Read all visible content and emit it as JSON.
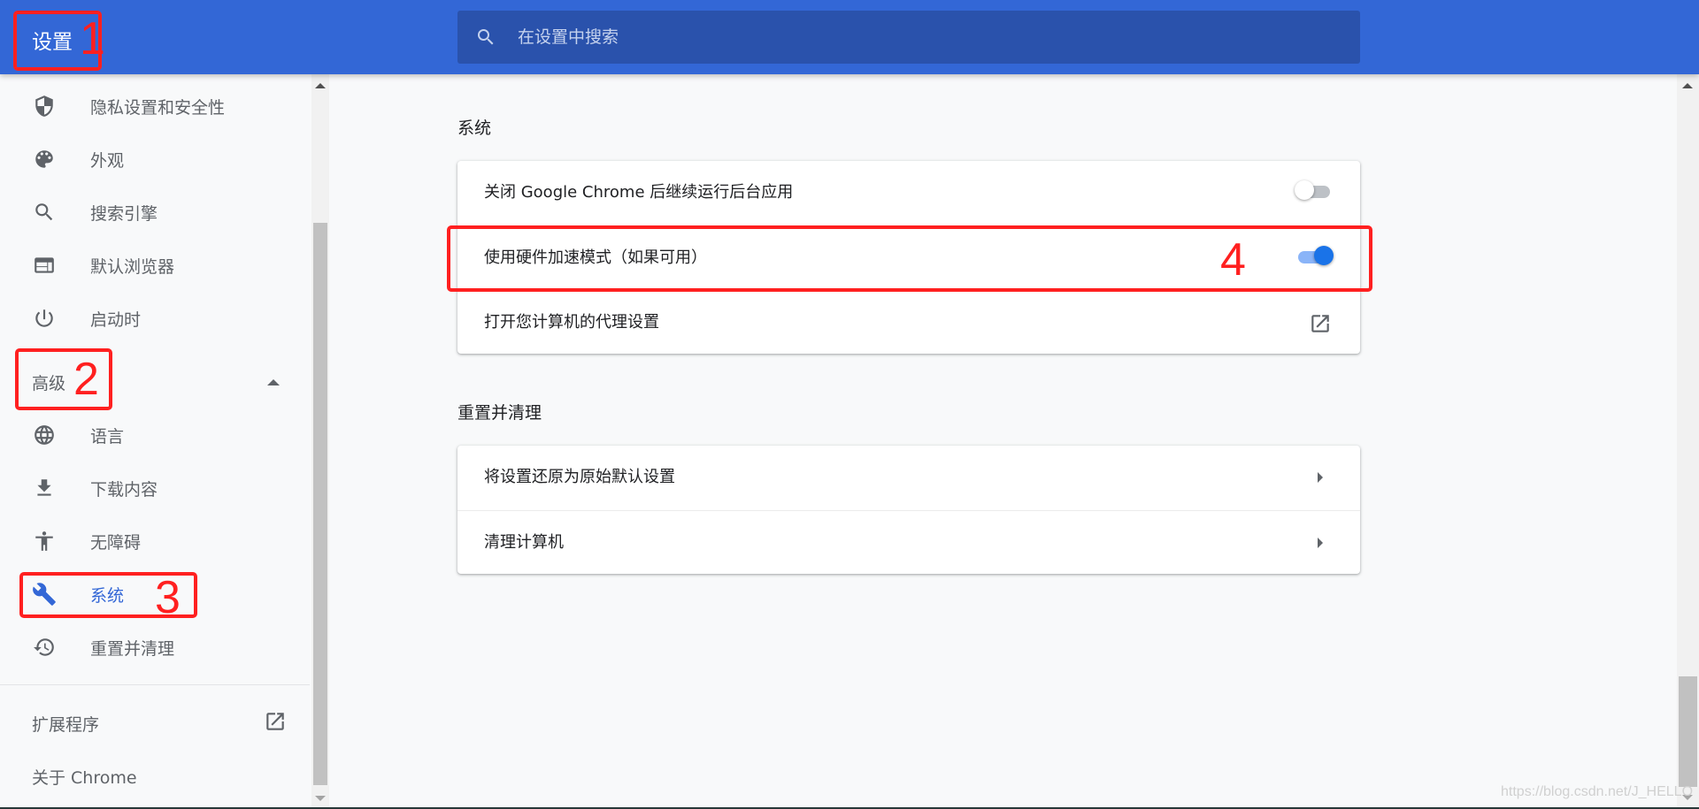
{
  "header": {
    "title": "设置",
    "search_placeholder": "在设置中搜索",
    "search_value": ""
  },
  "sidebar": {
    "items": [
      {
        "label": "隐私设置和安全性",
        "icon": "shield-icon"
      },
      {
        "label": "外观",
        "icon": "palette-icon"
      },
      {
        "label": "搜索引擎",
        "icon": "search-icon"
      },
      {
        "label": "默认浏览器",
        "icon": "browser-window-icon"
      },
      {
        "label": "启动时",
        "icon": "power-icon"
      }
    ],
    "advanced": {
      "label": "高级",
      "expanded": true
    },
    "advanced_items": [
      {
        "label": "语言",
        "icon": "globe-icon"
      },
      {
        "label": "下载内容",
        "icon": "download-icon"
      },
      {
        "label": "无障碍",
        "icon": "accessibility-icon"
      },
      {
        "label": "系统",
        "icon": "wrench-icon",
        "active": true
      },
      {
        "label": "重置并清理",
        "icon": "history-icon"
      }
    ],
    "extensions": {
      "label": "扩展程序",
      "icon": "open-in-new-icon"
    },
    "about": {
      "label": "关于 Chrome"
    }
  },
  "main": {
    "system": {
      "title": "系统",
      "rows": [
        {
          "label": "关闭 Google Chrome 后继续运行后台应用",
          "control": "toggle",
          "checked": false
        },
        {
          "label": "使用硬件加速模式（如果可用）",
          "control": "toggle",
          "checked": true
        },
        {
          "label": "打开您计算机的代理设置",
          "control": "external-link"
        }
      ]
    },
    "reset": {
      "title": "重置并清理",
      "rows": [
        {
          "label": "将设置还原为原始默认设置",
          "control": "arrow"
        },
        {
          "label": "清理计算机",
          "control": "arrow"
        }
      ]
    }
  },
  "annotations": [
    "1",
    "2",
    "3",
    "4"
  ],
  "colors": {
    "header": "#3367d6",
    "search_box": "#2a52ac",
    "active": "#3367d6",
    "toggle_on_knob": "#1a73e8",
    "toggle_on_track": "#8ab4f8",
    "annotation": "#ff2020"
  },
  "watermark": "https://blog.csdn.net/J_HELLO"
}
